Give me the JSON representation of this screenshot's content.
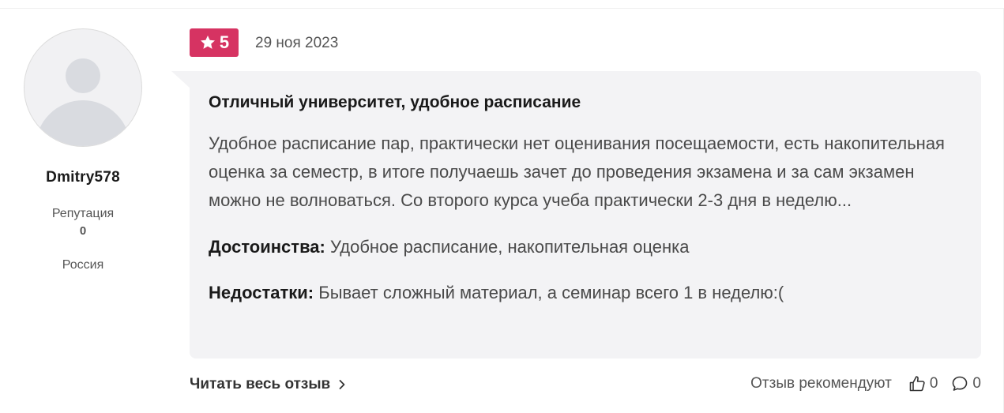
{
  "author": {
    "name": "Dmitry578",
    "reputation_label": "Репутация",
    "reputation_value": "0",
    "country": "Россия",
    "avatar_icon": "user-placeholder-icon"
  },
  "review": {
    "rating": "5",
    "rating_icon": "star-icon",
    "rating_color": "#d63362",
    "date": "29 ноя 2023",
    "title": "Отличный университет, удобное расписание",
    "text": "Удобное расписание пар, практически нет оценивания посещаемости, есть накопительная оценка за семестр, в итоге получаешь зачет до проведения экзамена и за сам экзамен можно не волноваться. Со второго курса учеба практически 2-3 дня в неделю...",
    "pros_label": "Достоинства:",
    "pros": "Удобное расписание, накопительная оценка",
    "cons_label": "Недостатки:",
    "cons": "Бывает сложный материал, а семинар всего 1 в неделю:(",
    "bubble_color": "#f3f3f5"
  },
  "footer": {
    "read_more": "Читать весь отзыв",
    "read_more_icon": "chevron-right-icon",
    "recommend_label": "Отзыв рекомендуют",
    "likes": "0",
    "likes_icon": "thumb-up-icon",
    "comments": "0",
    "comments_icon": "comment-icon"
  }
}
